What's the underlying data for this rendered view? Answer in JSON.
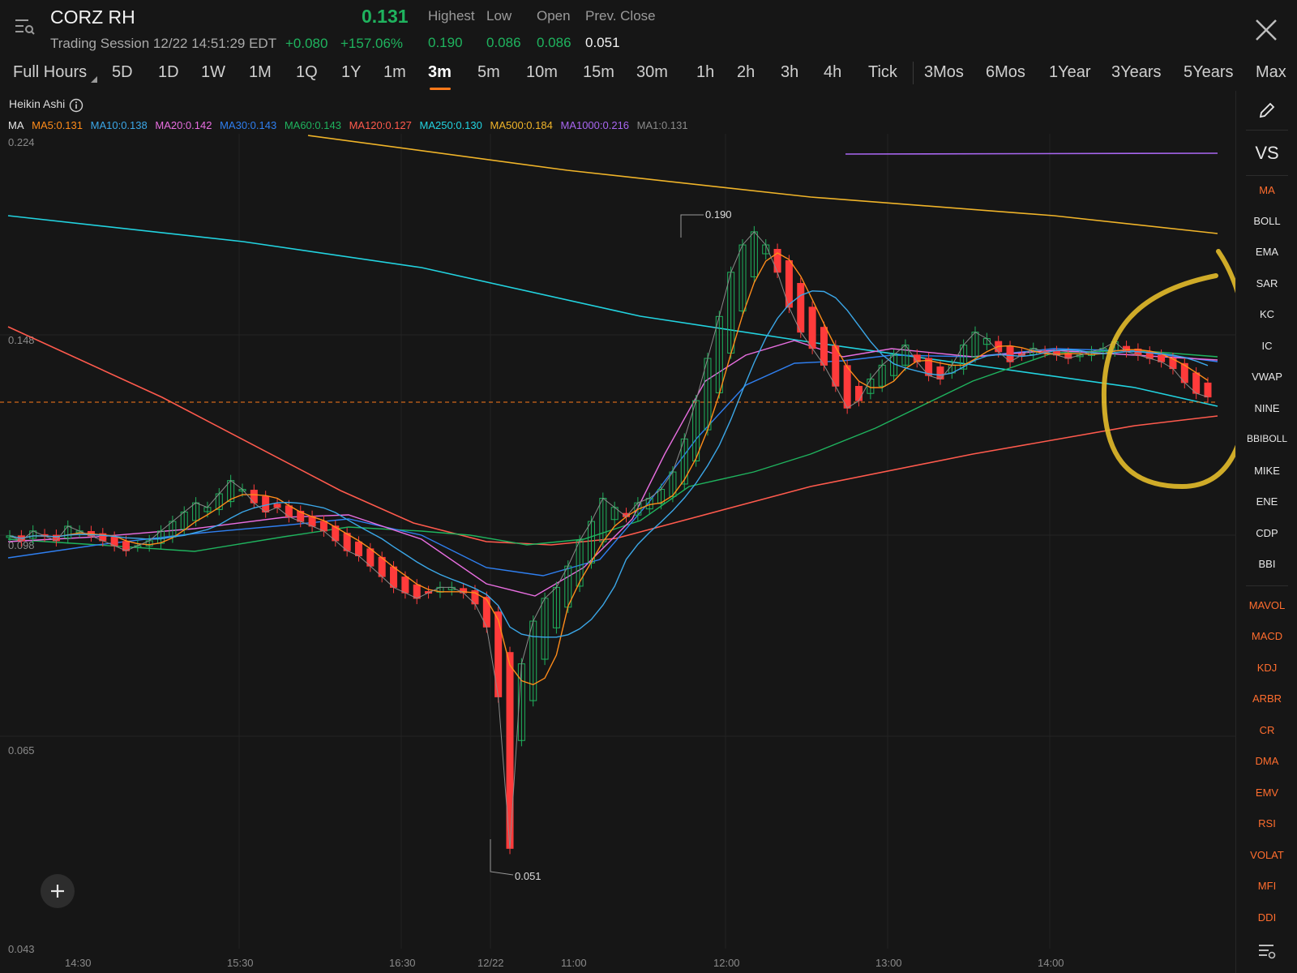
{
  "header": {
    "ticker": "CORZ RH",
    "session": "Trading Session 12/22 14:51:29 EDT",
    "price": "0.131",
    "change": "+0.080",
    "change_pct": "+157.06%",
    "stats": [
      {
        "label": "Highest",
        "value": "0.190"
      },
      {
        "label": "Low",
        "value": "0.086"
      },
      {
        "label": "Open",
        "value": "0.086"
      },
      {
        "label": "Prev. Close",
        "value": "0.051"
      }
    ],
    "up_color": "#1fb35e",
    "down_color": "#ff3b3b"
  },
  "tabs": {
    "items": [
      "Full Hours",
      "5D",
      "1D",
      "1W",
      "1M",
      "1Q",
      "1Y",
      "1m",
      "3m",
      "5m",
      "10m",
      "15m",
      "30m",
      "1h",
      "2h",
      "3h",
      "4h",
      "Tick",
      "3Mos",
      "6Mos",
      "1Year",
      "3Years",
      "5Years",
      "Max"
    ],
    "active": "3m"
  },
  "chart_type": "Heikin Ashi",
  "ma_legend": {
    "title": "MA",
    "items": [
      {
        "label": "MA5:0.131",
        "color": "#ff8c1a"
      },
      {
        "label": "MA10:0.138",
        "color": "#3ba7e8"
      },
      {
        "label": "MA20:0.142",
        "color": "#e86ee0"
      },
      {
        "label": "MA30:0.143",
        "color": "#2f7ff0"
      },
      {
        "label": "MA60:0.143",
        "color": "#1fb35e"
      },
      {
        "label": "MA120:0.127",
        "color": "#ff5a4d"
      },
      {
        "label": "MA250:0.130",
        "color": "#22d3e0"
      },
      {
        "label": "MA500:0.184",
        "color": "#f0b429"
      },
      {
        "label": "MA1000:0.216",
        "color": "#a866f0"
      },
      {
        "label": "MA1:0.131",
        "color": "#8a8a8a"
      }
    ]
  },
  "sidebar": {
    "vs_label": "VS",
    "main_indicators": [
      "MA",
      "BOLL",
      "EMA",
      "SAR",
      "KC",
      "IC",
      "VWAP",
      "NINE",
      "BBIBOLL",
      "MIKE",
      "ENE",
      "CDP",
      "BBI"
    ],
    "active_main": "MA",
    "sub_indicators": [
      "MAVOL",
      "MACD",
      "KDJ",
      "ARBR",
      "CR",
      "DMA",
      "EMV",
      "RSI",
      "VOLAT",
      "MFI",
      "DDI"
    ],
    "icons": [
      "pencil-icon",
      "settings-list-icon"
    ]
  },
  "chart_data": {
    "type": "candlestick",
    "y_ticks": [
      "0.224",
      "0.148",
      "0.098",
      "0.065",
      "0.043"
    ],
    "x_ticks": [
      "14:30",
      "15:30",
      "16:30",
      "12/22",
      "11:00",
      "12:00",
      "13:00",
      "14:00"
    ],
    "ylim": [
      0.043,
      0.224
    ],
    "y_scale": "log",
    "current_price": 0.131,
    "annotations": [
      {
        "label": "0.190",
        "time": "11:40",
        "value": 0.19
      },
      {
        "label": "0.051",
        "time": "12/22 pre-market",
        "value": 0.051
      }
    ],
    "series": [
      {
        "name": "MA500",
        "color": "#f0b429",
        "approx_values": [
          0.232,
          0.216,
          0.2,
          0.184
        ]
      },
      {
        "name": "MA1000",
        "color": "#a866f0",
        "approx_values": [
          0.218,
          0.216
        ]
      },
      {
        "name": "MA250",
        "color": "#22d3e0",
        "approx_values": [
          0.176,
          0.16,
          0.15,
          0.14,
          0.13
        ]
      },
      {
        "name": "MA120",
        "color": "#ff5a4d",
        "approx_values": [
          0.155,
          0.12,
          0.1,
          0.098,
          0.105,
          0.115,
          0.127
        ]
      }
    ],
    "closes": [
      0.098,
      0.097,
      0.099,
      0.098,
      0.097,
      0.1,
      0.099,
      0.098,
      0.097,
      0.096,
      0.095,
      0.096,
      0.097,
      0.099,
      0.101,
      0.103,
      0.105,
      0.104,
      0.107,
      0.11,
      0.108,
      0.105,
      0.103,
      0.104,
      0.102,
      0.101,
      0.1,
      0.099,
      0.097,
      0.095,
      0.094,
      0.092,
      0.09,
      0.088,
      0.087,
      0.086,
      0.087,
      0.088,
      0.088,
      0.087,
      0.085,
      0.081,
      0.07,
      0.051,
      0.075,
      0.082,
      0.086,
      0.088,
      0.092,
      0.097,
      0.101,
      0.106,
      0.104,
      0.102,
      0.105,
      0.106,
      0.108,
      0.112,
      0.12,
      0.13,
      0.142,
      0.155,
      0.17,
      0.18,
      0.185,
      0.18,
      0.17,
      0.158,
      0.15,
      0.145,
      0.14,
      0.134,
      0.128,
      0.13,
      0.136,
      0.14,
      0.143,
      0.146,
      0.141,
      0.137,
      0.136,
      0.14,
      0.146,
      0.15,
      0.148,
      0.144,
      0.141,
      0.143,
      0.145,
      0.144,
      0.143,
      0.142,
      0.143,
      0.144,
      0.145,
      0.147,
      0.144,
      0.143,
      0.142,
      0.141,
      0.139,
      0.135,
      0.132,
      0.131
    ]
  }
}
